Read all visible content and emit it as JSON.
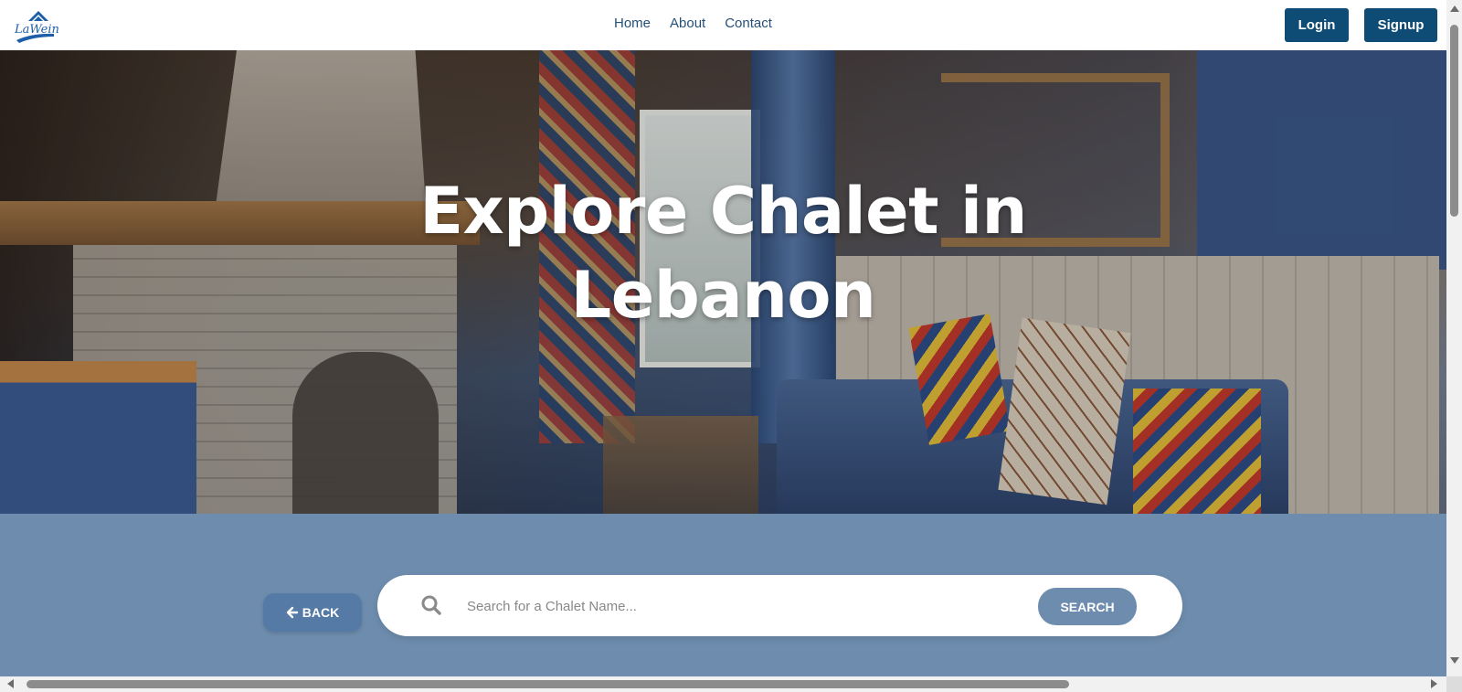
{
  "brand": {
    "logo_text": "LaWein",
    "logo_icon": "house-roof-logo"
  },
  "nav": {
    "links": [
      {
        "label": "Home"
      },
      {
        "label": "About"
      },
      {
        "label": "Contact"
      }
    ],
    "login_label": "Login",
    "signup_label": "Signup"
  },
  "hero": {
    "title_line1": "Explore Chalet in",
    "title_line2": "Lebanon",
    "background": "chalet-living-room-photo"
  },
  "search": {
    "back_label": "BACK",
    "back_icon": "arrow-left-icon",
    "placeholder": "Search for a Chalet Name...",
    "value": "",
    "search_icon": "search-icon",
    "button_label": "SEARCH"
  },
  "colors": {
    "brand_dark": "#0f4c75",
    "nav_link": "#24507a",
    "section_bg": "#6e8dae",
    "back_button": "#557aa6",
    "search_button": "#6e8dae"
  }
}
